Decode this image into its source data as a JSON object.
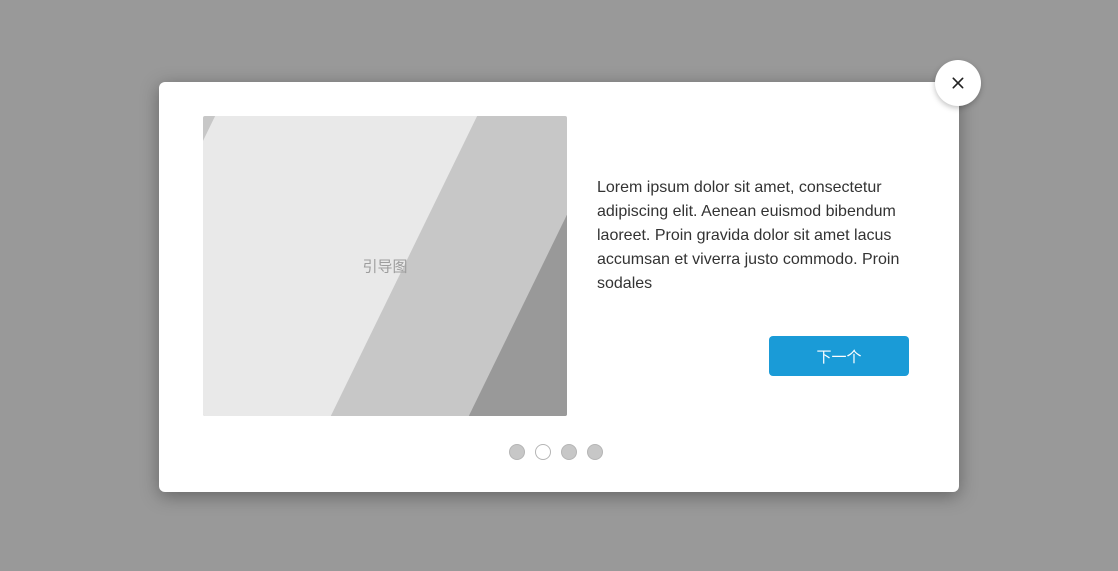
{
  "image": {
    "label": "引导图"
  },
  "content": {
    "description": "Lorem ipsum dolor sit amet, consectetur adipiscing elit. Aenean euismod bibendum laoreet. Proin gravida dolor sit amet lacus accumsan et viverra justo commodo. Proin sodales"
  },
  "actions": {
    "next_label": "下一个"
  },
  "pager": {
    "total": 4,
    "active_index": 1
  }
}
